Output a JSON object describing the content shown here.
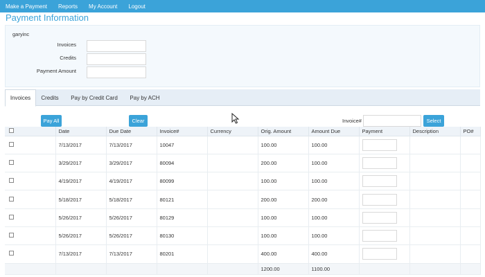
{
  "nav": [
    "Make a Payment",
    "Reports",
    "My Account",
    "Logout"
  ],
  "title": "Payment Information",
  "user": "garyinc",
  "fields": {
    "invoices": {
      "label": "Invoices",
      "value": ""
    },
    "credits": {
      "label": "Credits",
      "value": ""
    },
    "payment_amount": {
      "label": "Payment Amount",
      "value": ""
    }
  },
  "tabs": [
    "Invoices",
    "Credits",
    "Pay by Credit Card",
    "Pay by ACH"
  ],
  "buttons": {
    "pay_all": "Pay All",
    "clear": "Clear",
    "select": "Select"
  },
  "invoice_search": {
    "label": "Invoice#",
    "value": ""
  },
  "table": {
    "headers": [
      "Date",
      "Due Date",
      "Invoice#",
      "Currency",
      "Orig. Amount",
      "Amount Due",
      "Payment",
      "Description",
      "PO#"
    ],
    "rows": [
      {
        "date": "7/13/2017",
        "due": "7/13/2017",
        "invoice": "10047",
        "currency": "",
        "orig": "100.00",
        "amount_due": "100.00",
        "payment": "",
        "description": "",
        "po": ""
      },
      {
        "date": "3/29/2017",
        "due": "3/29/2017",
        "invoice": "80094",
        "currency": "",
        "orig": "200.00",
        "amount_due": "100.00",
        "payment": "",
        "description": "",
        "po": ""
      },
      {
        "date": "4/19/2017",
        "due": "4/19/2017",
        "invoice": "80099",
        "currency": "",
        "orig": "100.00",
        "amount_due": "100.00",
        "payment": "",
        "description": "",
        "po": ""
      },
      {
        "date": "5/18/2017",
        "due": "5/18/2017",
        "invoice": "80121",
        "currency": "",
        "orig": "200.00",
        "amount_due": "200.00",
        "payment": "",
        "description": "",
        "po": ""
      },
      {
        "date": "5/26/2017",
        "due": "5/26/2017",
        "invoice": "80129",
        "currency": "",
        "orig": "100.00",
        "amount_due": "100.00",
        "payment": "",
        "description": "",
        "po": ""
      },
      {
        "date": "5/26/2017",
        "due": "5/26/2017",
        "invoice": "80130",
        "currency": "",
        "orig": "100.00",
        "amount_due": "100.00",
        "payment": "",
        "description": "",
        "po": ""
      },
      {
        "date": "7/13/2017",
        "due": "7/13/2017",
        "invoice": "80201",
        "currency": "",
        "orig": "400.00",
        "amount_due": "400.00",
        "payment": "",
        "description": "",
        "po": ""
      }
    ],
    "totals": {
      "orig": "1200.00",
      "amount_due": "1100.00"
    }
  },
  "colors": {
    "accent": "#3ba3d9",
    "tab_bg": "#e6eef6",
    "panel_bg": "#f4f9fd"
  },
  "icons": {
    "cursor": "mouse-pointer-icon"
  }
}
